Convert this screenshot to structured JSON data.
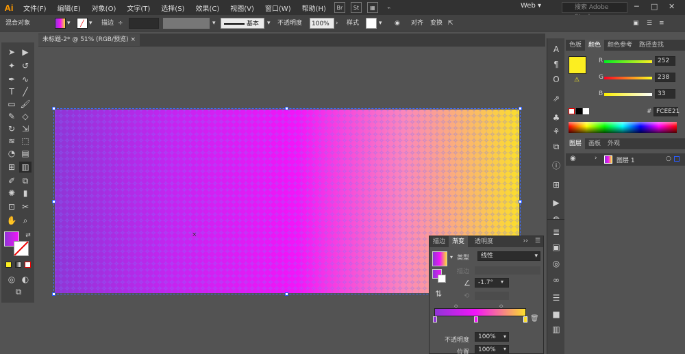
{
  "app": {
    "logo": "Ai"
  },
  "menu": [
    "文件(F)",
    "编辑(E)",
    "对象(O)",
    "文字(T)",
    "选择(S)",
    "效果(C)",
    "视图(V)",
    "窗口(W)",
    "帮助(H)"
  ],
  "menubar_buttons": {
    "bridge": "Br",
    "stock": "St"
  },
  "workspace": "Web",
  "search_placeholder": "搜索 Adobe Stock",
  "control": {
    "object_type": "混合对象",
    "stroke_label": "描边",
    "brush_label": "基本",
    "opacity_label": "不透明度",
    "opacity_value": "100%",
    "style_label": "样式",
    "align_label": "对齐",
    "transform_label": "变换"
  },
  "document_tab": {
    "title": "未标题-2* @ 51% (RGB/预览)",
    "close": "×"
  },
  "color_panel": {
    "tabs": [
      "色板",
      "颜色",
      "颜色参考",
      "路径查找"
    ],
    "active_tab": "颜色",
    "r": "252",
    "g": "238",
    "b": "33",
    "hex": "FCEE21",
    "swatch_color": "#fcee21"
  },
  "layers_panel": {
    "tabs": [
      "图层",
      "画板",
      "外观"
    ],
    "active_tab": "图层",
    "layer_name": "图层 1"
  },
  "gradient_panel": {
    "tabs": [
      "描边",
      "渐变",
      "透明度"
    ],
    "active_tab": "渐变",
    "type_label": "类型",
    "type_value": "线性",
    "edit_label": "描边",
    "angle_value": "-1.7°",
    "opacity_label": "不透明度",
    "opacity_value": "100%",
    "location_label": "位置",
    "location_value": "100%"
  },
  "colors": {
    "grad_start": "#8f35d6",
    "grad_mid": "#f215f8",
    "grad_end": "#fbde2c",
    "fill_swatch": "#fcee21"
  }
}
